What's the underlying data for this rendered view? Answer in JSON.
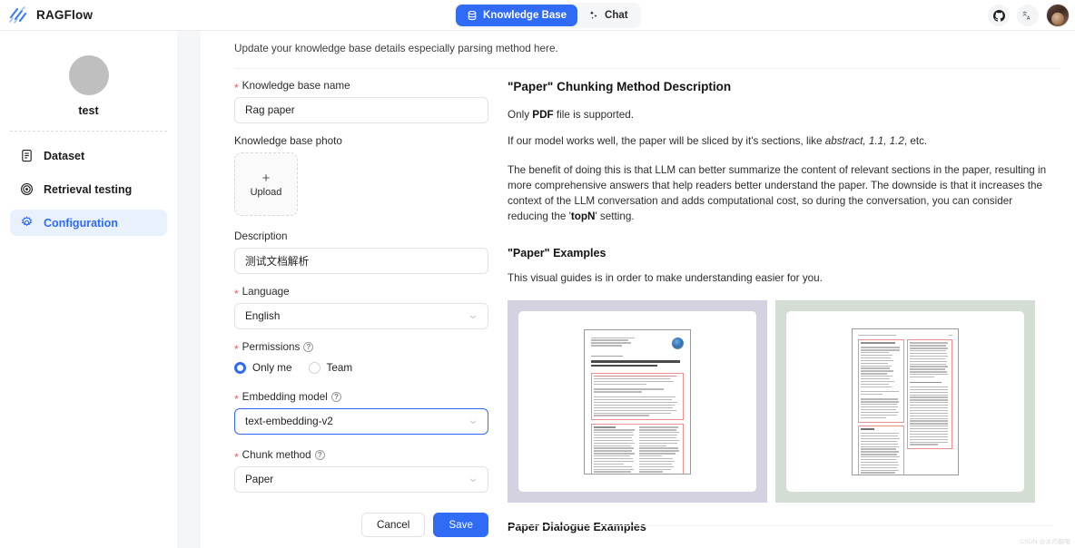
{
  "app": {
    "brand_name": "RAGFlow",
    "logo_icon": "ragflow-logo-icon"
  },
  "nav": {
    "tabs": [
      {
        "label": "Knowledge Base",
        "icon": "database-icon",
        "active": true
      },
      {
        "label": "Chat",
        "icon": "chat-sparkle-icon",
        "active": false
      }
    ],
    "github_icon": "github-icon",
    "language_icon": "translate-icon",
    "avatar_icon": "user-avatar"
  },
  "sidebar": {
    "kb_name": "test",
    "avatar_icon": "knowledge-base-avatar",
    "items": [
      {
        "label": "Dataset",
        "icon": "file-text-icon",
        "active": false
      },
      {
        "label": "Retrieval testing",
        "icon": "target-icon",
        "active": false
      },
      {
        "label": "Configuration",
        "icon": "gear-icon",
        "active": true
      }
    ]
  },
  "main": {
    "update_note": "Update your knowledge base details especially parsing method here.",
    "form": {
      "name_label": "Knowledge base name",
      "name_value": "Rag paper",
      "photo_label": "Knowledge base photo",
      "upload_plus": "+",
      "upload_label": "Upload",
      "description_label": "Description",
      "description_value": "测试文档解析",
      "language_label": "Language",
      "language_value": "English",
      "permissions_label": "Permissions",
      "permission_only_me": "Only me",
      "permission_team": "Team",
      "permission_selected": "Only me",
      "embedding_label": "Embedding model",
      "embedding_value": "text-embedding-v2",
      "chunk_label": "Chunk method",
      "chunk_value": "Paper",
      "cancel_label": "Cancel",
      "save_label": "Save"
    },
    "doc": {
      "title": "\"Paper\" Chunking Method Description",
      "p1_pre": "Only ",
      "p1_bold": "PDF",
      "p1_post": " file is supported.",
      "p2_pre": "If our model works well, the paper will be sliced by it's sections, like ",
      "p2_italic": "abstract, 1.1, 1.2",
      "p2_post": ", etc.",
      "p3_pre": "The benefit of doing this is that LLM can better summarize the content of relevant sections in the paper, resulting in more comprehensive answers that help readers better understand the paper. The downside is that it increases the context of the LLM conversation and adds computational cost, so during the conversation, you can consider reducing the '",
      "p3_bold": "topN",
      "p3_post": "' setting.",
      "examples_title": "\"Paper\" Examples",
      "examples_sub": "This visual guides is in order to make understanding easier for you.",
      "example_1_alt": "paper-single-column-chunking-example",
      "example_2_alt": "paper-two-column-chunking-example",
      "dialogue_title": "Paper Dialogue Examples"
    },
    "watermark": "CSDN @水的翻唱"
  },
  "colors": {
    "accent": "#2f6bf5",
    "accent_soft": "#eaf1fe",
    "required_star": "#f5575c",
    "gutter": "#f5f6f8",
    "example_bg_1": "#d4d2e0",
    "example_bg_2": "#d4ddd4",
    "annotation_box": "#f0908c"
  }
}
